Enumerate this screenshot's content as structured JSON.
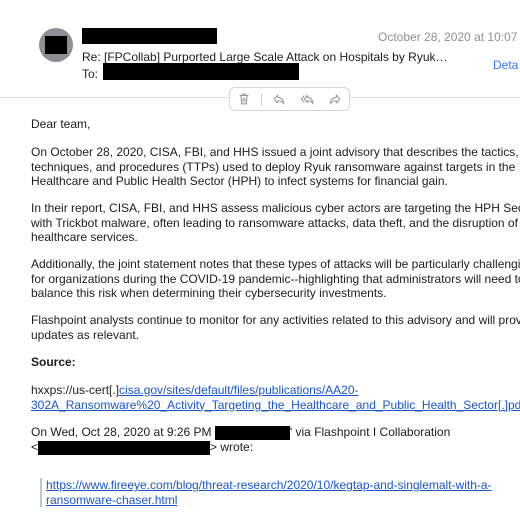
{
  "header": {
    "date": "October 28, 2020 at 10:07 P",
    "subject": "Re: [FPCollab] Purported Large Scale Attack on Hospitals by Ryuk…",
    "to_label": "To:",
    "details_label": "Deta"
  },
  "toolbar": {
    "icons": [
      "trash-icon",
      "reply-icon",
      "reply-all-icon",
      "forward-icon"
    ]
  },
  "body": {
    "greeting": "Dear team,",
    "p1": [
      "On October 28, 2020, CISA, FBI, and HHS issued a joint advisory that describes the tactics,",
      "techniques, and procedures (TTPs) used to deploy Ryuk ransomware against targets in the",
      "Healthcare and Public Health Sector (HPH) to infect systems for financial gain."
    ],
    "p2": [
      "In their report, CISA, FBI, and HHS assess malicious cyber actors are targeting the HPH Sec",
      "with Trickbot malware, often leading to ransomware attacks, data theft, and the disruption of",
      "healthcare services."
    ],
    "p3": [
      "Additionally, the joint statement notes that these types of attacks will be particularly challengi",
      "for organizations during the COVID-19 pandemic--highlighting that administrators will need to",
      "balance this risk when determining their cybersecurity investments."
    ],
    "p4": [
      "Flashpoint analysts continue to monitor for any activities related to this advisory and will prov",
      "updates as relevant."
    ],
    "source_label": "Source:",
    "source_prefix": "hxxps://us-cert[.]",
    "source_link_1": "cisa.gov/sites/default/files/publications/AA20-",
    "source_link_2": "302A_Ransomware%20_Activity_Targeting_the_Healthcare_and_Public_Health_Sector[.]pd",
    "reply_intro": "On Wed, Oct 28, 2020 at 9:26 PM",
    "reply_via": "' via Flashpoint I Collaboration",
    "reply_lt": "<",
    "reply_wrote": "> wrote:"
  },
  "quote": {
    "link_1": "https://www.fireeye.com/blog/threat-research/2020/10/kegtap-and-singlemalt-with-a-",
    "link_2": "ransomware-chaser.html"
  }
}
